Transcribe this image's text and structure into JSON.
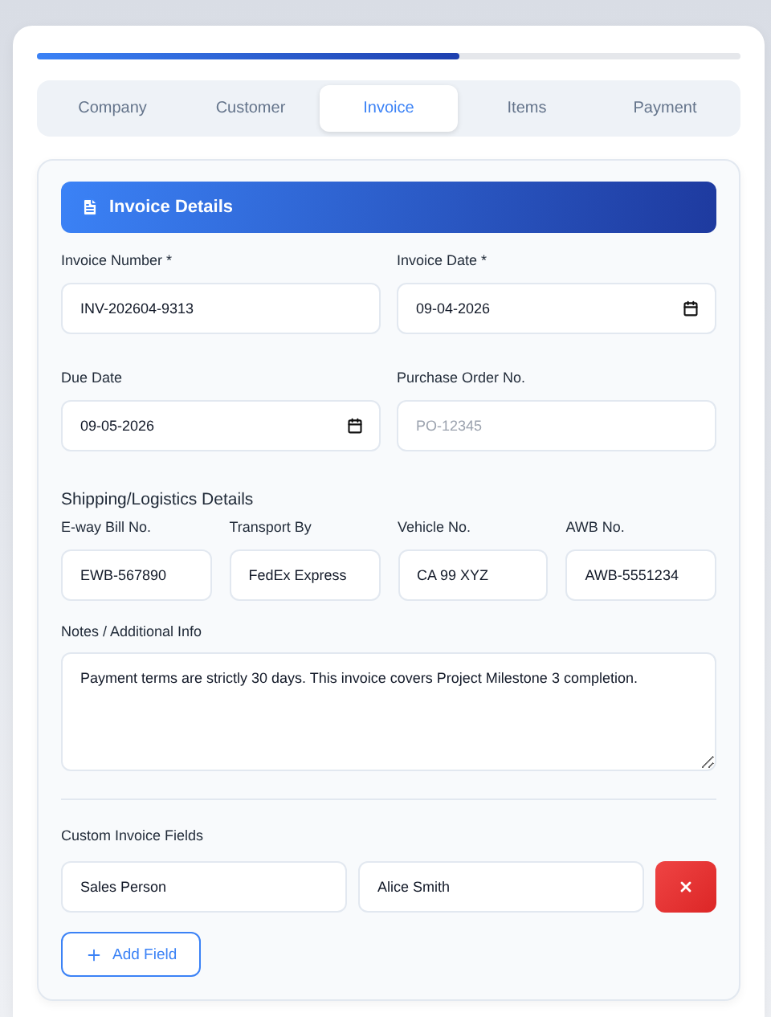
{
  "progress": {
    "level": 0.6
  },
  "tabs": [
    {
      "label": "Company",
      "selected": false
    },
    {
      "label": "Customer",
      "selected": false
    },
    {
      "label": "Invoice",
      "selected": true
    },
    {
      "label": "Items",
      "selected": false
    },
    {
      "label": "Payment",
      "selected": false
    }
  ],
  "section_header": {
    "title": "Invoice Details"
  },
  "main_fields": [
    {
      "label": "Invoice Number *",
      "kind": "text",
      "value": "INV-202604-9313"
    },
    {
      "label": "Invoice Date *",
      "kind": "date",
      "value": "09-04-2026"
    },
    {
      "label": "Due Date",
      "kind": "date",
      "value": "09-05-2026"
    },
    {
      "label": "Purchase Order No.",
      "kind": "text",
      "placeholder": "PO-12345"
    }
  ],
  "shipping": {
    "title": "Shipping/Logistics Details",
    "fields": [
      {
        "label": "E-way Bill No.",
        "value": "EWB-567890"
      },
      {
        "label": "Transport By",
        "value": "FedEx Express"
      },
      {
        "label": "Vehicle No.",
        "value": "CA 99 XYZ"
      },
      {
        "label": "AWB No.",
        "value": "AWB-5551234"
      }
    ]
  },
  "notes": {
    "label": "Notes / Additional Info",
    "value": "Payment terms are strictly 30 days. This invoice covers Project Milestone 3 completion."
  },
  "custom_fields": {
    "label": "Custom Invoice Fields",
    "rows": [
      {
        "name": "Sales Person",
        "value": "Alice Smith"
      }
    ],
    "add_button": "Add Field"
  }
}
